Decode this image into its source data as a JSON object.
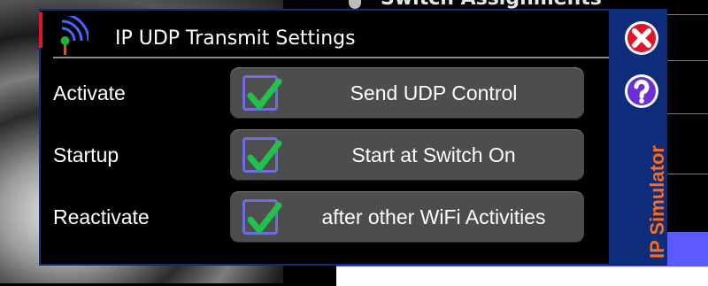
{
  "background": {
    "title": "Switch Assignments"
  },
  "dialog": {
    "title": "IP UDP Transmit Settings",
    "icon": "wifi-antenna-icon",
    "side_label": "IP Simulator",
    "close_icon": "close-icon",
    "help_icon": "help-icon",
    "accent_color": "#ff6a1a"
  },
  "rows": [
    {
      "label": "Activate",
      "button": "Send UDP Control",
      "checked": true
    },
    {
      "label": "Startup",
      "button": "Start at Switch On",
      "checked": true
    },
    {
      "label": "Reactivate",
      "button": "after other WiFi Activities",
      "checked": true
    }
  ]
}
